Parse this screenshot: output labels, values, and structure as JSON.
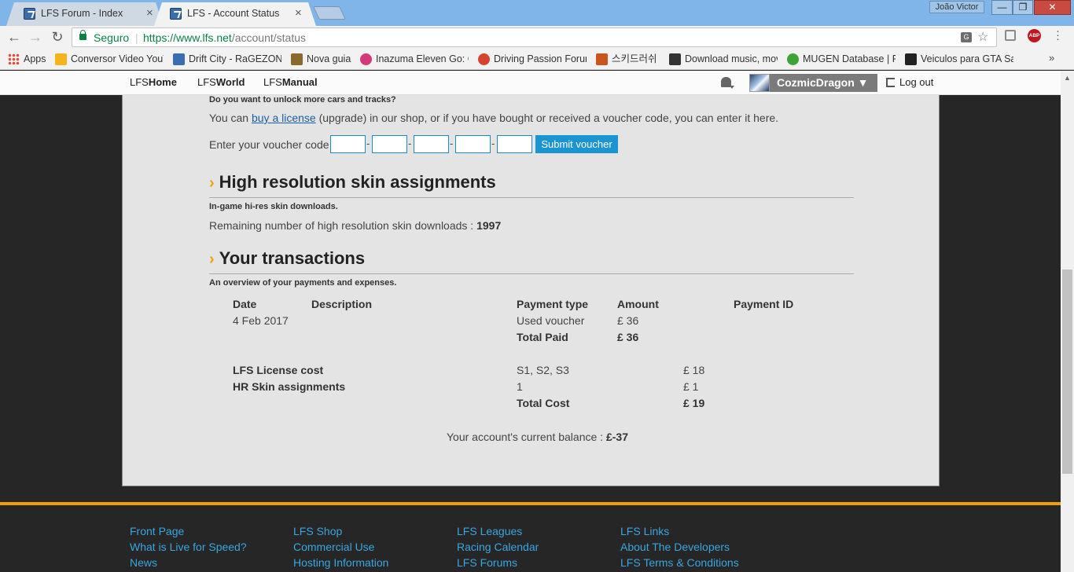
{
  "browser": {
    "tabs": [
      {
        "title": "LFS Forum - Index"
      },
      {
        "title": "LFS - Account Status"
      }
    ],
    "profile_name": "João Victor",
    "window_buttons": {
      "minimize": "—",
      "maximize": "❐",
      "close": "✕"
    },
    "nav": {
      "back": "←",
      "forward": "→",
      "reload": "↻"
    },
    "secure_label": "Seguro",
    "url_host": "https://www.lfs.net",
    "url_path": "/account/status",
    "bookmarks": [
      {
        "label": "Apps",
        "color": "#e04b3a"
      },
      {
        "label": "Conversor Video YouT",
        "color": "#f3b51b"
      },
      {
        "label": "Drift City - RaGEZONE",
        "color": "#3b6db3"
      },
      {
        "label": "Nova guia",
        "color": "#8a6a2a"
      },
      {
        "label": "Inazuma Eleven Go: Cl",
        "color": "#d4387a"
      },
      {
        "label": "Driving Passion Forum",
        "color": "#d6442e"
      },
      {
        "label": "스키드러쉬",
        "color": "#c9551f"
      },
      {
        "label": "Download music, mov",
        "color": "#333333"
      },
      {
        "label": "MUGEN Database | Fa",
        "color": "#3fa33a"
      },
      {
        "label": "Veiculos para GTA Sa",
        "color": "#222222"
      }
    ],
    "bookmarks_more": "»"
  },
  "site": {
    "nav": [
      {
        "prefix": "LFS",
        "label": "Home"
      },
      {
        "prefix": "LFS",
        "label": "World"
      },
      {
        "prefix": "LFS",
        "label": "Manual"
      }
    ],
    "username": "CozmicDragon ▼",
    "logout": "Log out"
  },
  "unlock": {
    "heading": "Do you want to unlock more cars and tracks?",
    "text_before": "You can ",
    "link": "buy a license",
    "text_after": " (upgrade) in our shop, or if you have bought or received a voucher code, you can enter it here.",
    "voucher_label": "Enter your voucher code :",
    "submit": "Submit voucher"
  },
  "skins": {
    "heading": "High resolution skin assignments",
    "sub": "In-game hi-res skin downloads.",
    "remaining_label": "Remaining number of high resolution skin downloads : ",
    "remaining_value": "1997"
  },
  "transactions": {
    "heading": "Your transactions",
    "sub": "An overview of your payments and expenses.",
    "columns": {
      "date": "Date",
      "description": "Description",
      "payment_type": "Payment type",
      "amount": "Amount",
      "payment_id": "Payment ID"
    },
    "rows": [
      {
        "date": "4 Feb 2017",
        "payment_type": "Used voucher",
        "amount": "£ 36"
      }
    ],
    "total_paid_label": "Total Paid",
    "total_paid_value": "£ 36",
    "costs": [
      {
        "name": "LFS License cost",
        "detail": "S1, S2, S3",
        "amount": "£ 18"
      },
      {
        "name": "HR Skin assignments",
        "detail": "1",
        "amount": "£ 1"
      }
    ],
    "total_cost_label": "Total Cost",
    "total_cost_value": "£ 19",
    "balance_label": "Your account's current balance : ",
    "balance_value": "£-37"
  },
  "footer": {
    "columns": [
      [
        "Front Page",
        "What is Live for Speed?",
        "News"
      ],
      [
        "LFS Shop",
        "Commercial Use",
        "Hosting Information"
      ],
      [
        "LFS Leagues",
        "Racing Calendar",
        "LFS Forums"
      ],
      [
        "LFS Links",
        "About The Developers",
        "LFS Terms & Conditions"
      ]
    ]
  }
}
